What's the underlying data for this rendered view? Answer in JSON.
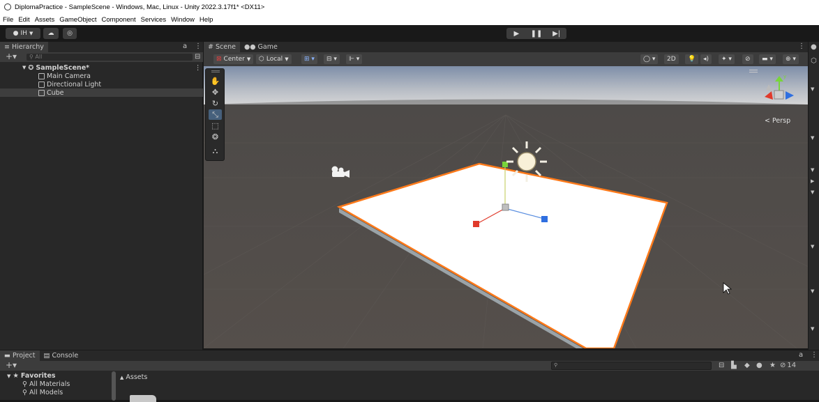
{
  "window": {
    "title": "DiplomaPractice - SampleScene - Windows, Mac, Linux - Unity 2022.3.17f1* <DX11>"
  },
  "menu": [
    "File",
    "Edit",
    "Assets",
    "GameObject",
    "Component",
    "Services",
    "Window",
    "Help"
  ],
  "toolbar": {
    "account_label": "IH",
    "play_icon": "play-icon",
    "pause_icon": "pause-icon",
    "step_icon": "step-icon"
  },
  "hierarchy": {
    "tab_label": "Hierarchy",
    "search_placeholder": "All",
    "scene_name": "SampleScene*",
    "items": [
      {
        "label": "Main Camera"
      },
      {
        "label": "Directional Light"
      },
      {
        "label": "Cube",
        "selected": true
      }
    ]
  },
  "scene": {
    "tabs": [
      {
        "label": "Scene",
        "active": true
      },
      {
        "label": "Game",
        "active": false
      }
    ],
    "pivot_label": "Center",
    "space_label": "Local",
    "mode_2d_label": "2D",
    "gizmo_label": "Persp",
    "gizmo_axes": [
      "y"
    ]
  },
  "bottom": {
    "tabs": [
      {
        "label": "Project",
        "active": true
      },
      {
        "label": "Console",
        "active": false
      }
    ],
    "favorites_label": "Favorites",
    "favorites": [
      "All Materials",
      "All Models"
    ],
    "assets_label": "Assets",
    "hidden_count": "14"
  },
  "colors": {
    "accent_select": "#46607c",
    "selection_outline": "#ff7a1a",
    "axis_x": "#e03a2b",
    "axis_y": "#78d53a",
    "axis_z": "#2f6fe0"
  }
}
